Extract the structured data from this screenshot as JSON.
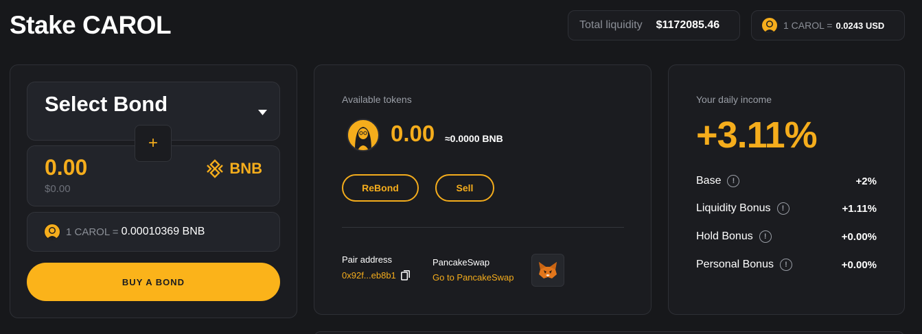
{
  "header": {
    "title": "Stake CAROL",
    "total_liquidity_label": "Total liquidity",
    "total_liquidity_value": "$1172085.46",
    "price_label": "1 CAROL =",
    "price_value": "0.0243 USD"
  },
  "bond_panel": {
    "select_label": "Select Bond",
    "plus_symbol": "+",
    "amount": "0.00",
    "amount_usd": "$0.00",
    "token_name": "BNB",
    "rate_label": "1 CAROL =",
    "rate_value": "0.00010369 BNB",
    "buy_button": "BUY A BOND"
  },
  "tokens_panel": {
    "available_label": "Available tokens",
    "available_amount": "0.00",
    "available_bnb": "≈0.0000 BNB",
    "rebond_button": "ReBond",
    "sell_button": "Sell",
    "pair_address_label": "Pair address",
    "pair_address_value": "0x92f...eb8b1",
    "pancakeswap_label": "PancakeSwap",
    "pancakeswap_link": "Go to PancakeSwap"
  },
  "income_panel": {
    "label": "Your daily income",
    "value": "+3.11%",
    "rows": [
      {
        "label": "Base",
        "value": "+2%"
      },
      {
        "label": "Liquidity Bonus",
        "value": "+1.11%"
      },
      {
        "label": "Hold Bonus",
        "value": "+0.00%"
      },
      {
        "label": "Personal Bonus",
        "value": "+0.00%"
      }
    ]
  },
  "colors": {
    "accent": "#f5ad1c",
    "background": "#17181b",
    "card": "#1b1c20"
  },
  "icons": [
    "carol-avatar-icon",
    "caret-down-icon",
    "bnb-logo-icon",
    "copy-icon",
    "metamask-fox-icon",
    "info-icon"
  ]
}
